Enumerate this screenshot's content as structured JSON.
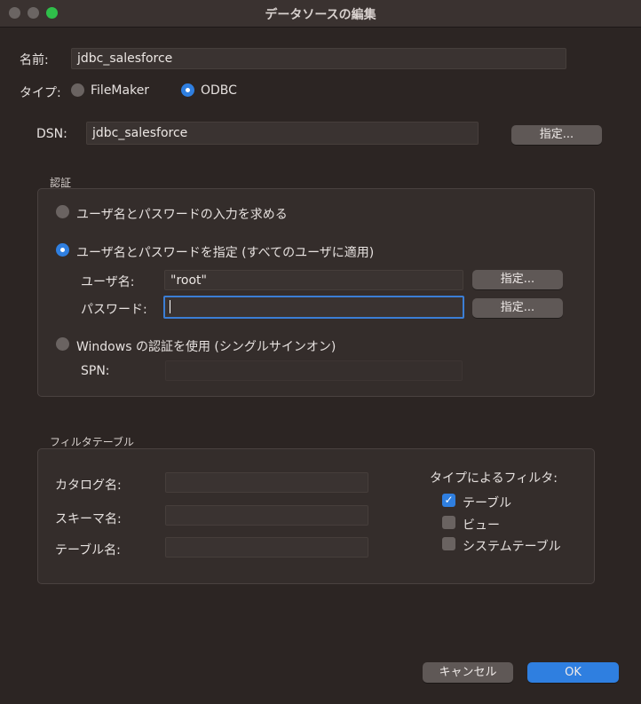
{
  "window": {
    "title": "データソースの編集"
  },
  "name": {
    "label": "名前:",
    "value": "jdbc_salesforce"
  },
  "type": {
    "label": "タイプ:",
    "options": [
      "FileMaker",
      "ODBC"
    ],
    "selected": "ODBC"
  },
  "dsn": {
    "label": "DSN:",
    "value": "jdbc_salesforce",
    "button": "指定..."
  },
  "auth": {
    "section_label": "認証",
    "option_prompt": "ユーザ名とパスワードの入力を求める",
    "option_specify": "ユーザ名とパスワードを指定 (すべてのユーザに適用)",
    "selected": "option_specify",
    "username_label": "ユーザ名:",
    "username_value": "\"root\"",
    "username_button": "指定...",
    "password_label": "パスワード:",
    "password_value": "",
    "password_button": "指定...",
    "option_windows": "Windows の認証を使用 (シングルサインオン)",
    "spn_label": "SPN:",
    "spn_value": ""
  },
  "filter": {
    "section_label": "フィルタテーブル",
    "catalog_label": "カタログ名:",
    "catalog_value": "",
    "schema_label": "スキーマ名:",
    "schema_value": "",
    "table_label": "テーブル名:",
    "table_value": "",
    "type_filter_label": "タイプによるフィルタ:",
    "types": [
      {
        "label": "テーブル",
        "checked": true
      },
      {
        "label": "ビュー",
        "checked": false
      },
      {
        "label": "システムテーブル",
        "checked": false
      }
    ]
  },
  "footer": {
    "cancel": "キャンセル",
    "ok": "OK"
  },
  "colors": {
    "accent": "#2f7fe0",
    "background": "#2c2523",
    "close": "#6b6563"
  }
}
